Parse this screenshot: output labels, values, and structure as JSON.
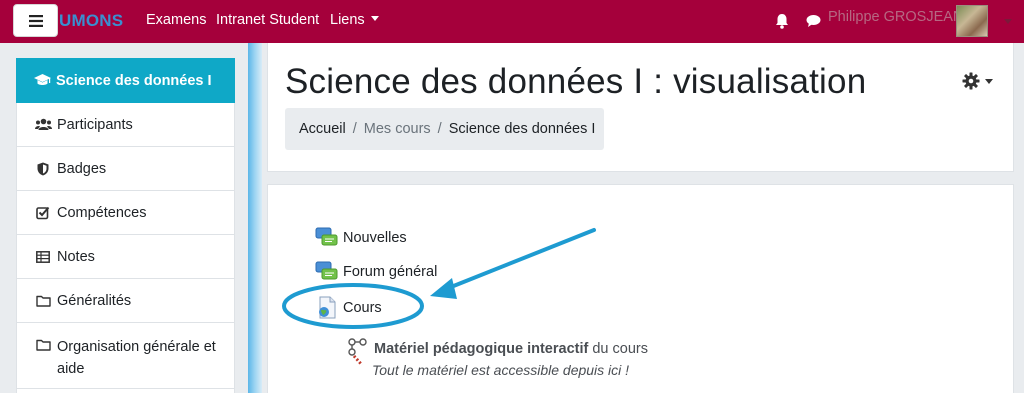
{
  "navbar": {
    "brand": "UMONS",
    "links": [
      "Examens",
      "Intranet Student",
      "Liens"
    ],
    "user_name": "Philippe GROSJEAN",
    "colors": {
      "background": "#a5003b",
      "brand": "#3a8fd0"
    },
    "icons": [
      "menu-icon",
      "bell-icon",
      "chat-icon"
    ]
  },
  "sidebar": {
    "items": [
      {
        "label": "Science des données I",
        "icon": "graduation-cap-icon",
        "active": true
      },
      {
        "label": "Participants",
        "icon": "users-icon"
      },
      {
        "label": "Badges",
        "icon": "shield-icon"
      },
      {
        "label": "Compétences",
        "icon": "checkbox-icon"
      },
      {
        "label": "Notes",
        "icon": "table-icon"
      },
      {
        "label": "Généralités",
        "icon": "folder-icon"
      },
      {
        "label": "Organisation générale et aide",
        "icon": "folder-icon"
      }
    ],
    "active_color": "#0fa8c7"
  },
  "header": {
    "title": "Science des données I : visualisation",
    "breadcrumb": [
      "Accueil",
      "Mes cours",
      "Science des données I"
    ],
    "settings_icon": "gear-icon"
  },
  "content": {
    "activities": [
      {
        "label": "Nouvelles",
        "icon": "forum-icon"
      },
      {
        "label": "Forum général",
        "icon": "forum-icon"
      },
      {
        "label": "Cours",
        "icon": "web-page-icon",
        "highlighted": true
      }
    ],
    "resource": {
      "title": "Matériel pédagogique interactif",
      "suffix": " du cours",
      "description": "Tout le matériel est accessible depuis ici !",
      "icon": "molecule-icon"
    },
    "annotation_color": "#1e9bd1"
  }
}
